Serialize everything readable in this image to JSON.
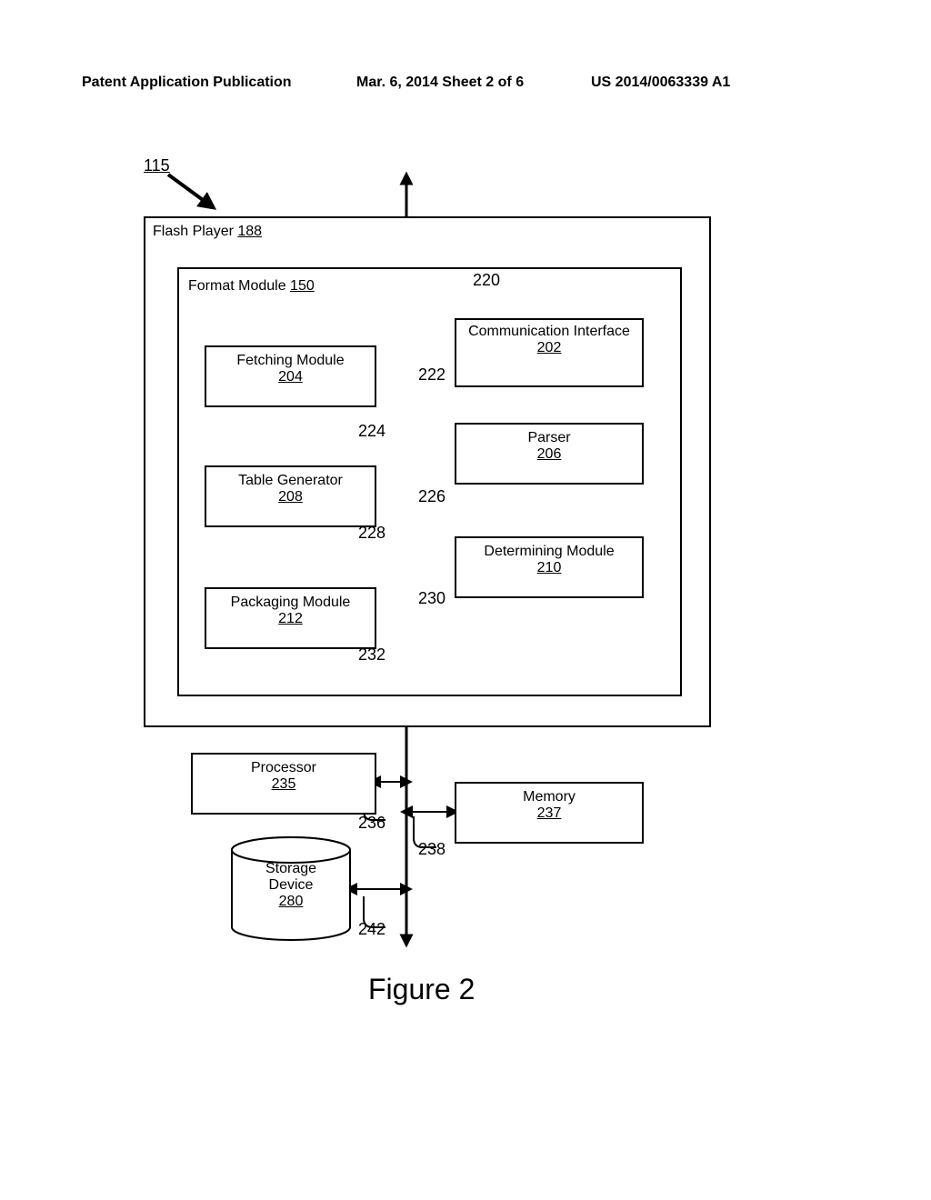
{
  "header": {
    "left": "Patent Application Publication",
    "center": "Mar. 6, 2014   Sheet 2 of 6",
    "right": "US 2014/0063339 A1"
  },
  "system_ref": "115",
  "outer": {
    "title": "Flash Player",
    "num": "188"
  },
  "inner": {
    "title": "Format Module",
    "num": "150"
  },
  "blocks": {
    "comm": {
      "title": "Communication Interface",
      "num": "202"
    },
    "fetch": {
      "title": "Fetching Module",
      "num": "204"
    },
    "parser": {
      "title": "Parser",
      "num": "206"
    },
    "tgen": {
      "title": "Table Generator",
      "num": "208"
    },
    "det": {
      "title": "Determining Module",
      "num": "210"
    },
    "pkg": {
      "title": "Packaging Module",
      "num": "212"
    },
    "proc": {
      "title": "Processor",
      "num": "235"
    },
    "mem": {
      "title": "Memory",
      "num": "237"
    },
    "store": {
      "title": "Storage Device",
      "num": "280"
    }
  },
  "conn": {
    "c220": "220",
    "c222": "222",
    "c224": "224",
    "c226": "226",
    "c228": "228",
    "c230": "230",
    "c232": "232",
    "c236": "236",
    "c238": "238",
    "c242": "242"
  },
  "figure_caption": "Figure 2"
}
